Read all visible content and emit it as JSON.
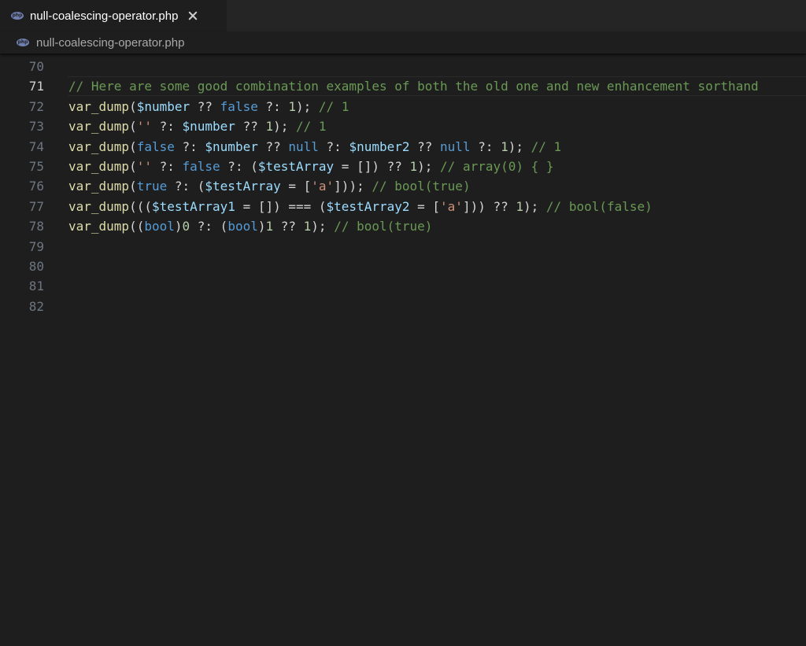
{
  "tab": {
    "label": "null-coalescing-operator.php",
    "icon": "php-file-icon"
  },
  "breadcrumb": {
    "label": "null-coalescing-operator.php",
    "icon": "php-file-icon"
  },
  "editor": {
    "current_line": 71,
    "lines": [
      {
        "number": "70",
        "tokens": []
      },
      {
        "number": "71",
        "tokens": [
          {
            "t": "cmt",
            "v": "// Here are some good combination examples of both the old one and new enhancement sorthand"
          }
        ]
      },
      {
        "number": "72",
        "tokens": [
          {
            "t": "fn",
            "v": "var_dump"
          },
          {
            "t": "pun",
            "v": "("
          },
          {
            "t": "var",
            "v": "$number"
          },
          {
            "t": "pun",
            "v": " ?? "
          },
          {
            "t": "kw",
            "v": "false"
          },
          {
            "t": "pun",
            "v": " ?: "
          },
          {
            "t": "num",
            "v": "1"
          },
          {
            "t": "pun",
            "v": "); "
          },
          {
            "t": "cmt",
            "v": "// 1"
          }
        ]
      },
      {
        "number": "73",
        "tokens": [
          {
            "t": "fn",
            "v": "var_dump"
          },
          {
            "t": "pun",
            "v": "("
          },
          {
            "t": "str",
            "v": "''"
          },
          {
            "t": "pun",
            "v": " ?: "
          },
          {
            "t": "var",
            "v": "$number"
          },
          {
            "t": "pun",
            "v": " ?? "
          },
          {
            "t": "num",
            "v": "1"
          },
          {
            "t": "pun",
            "v": "); "
          },
          {
            "t": "cmt",
            "v": "// 1"
          }
        ]
      },
      {
        "number": "74",
        "tokens": [
          {
            "t": "fn",
            "v": "var_dump"
          },
          {
            "t": "pun",
            "v": "("
          },
          {
            "t": "kw",
            "v": "false"
          },
          {
            "t": "pun",
            "v": " ?: "
          },
          {
            "t": "var",
            "v": "$number"
          },
          {
            "t": "pun",
            "v": " ?? "
          },
          {
            "t": "kw",
            "v": "null"
          },
          {
            "t": "pun",
            "v": " ?: "
          },
          {
            "t": "var",
            "v": "$number2"
          },
          {
            "t": "pun",
            "v": " ?? "
          },
          {
            "t": "kw",
            "v": "null"
          },
          {
            "t": "pun",
            "v": " ?: "
          },
          {
            "t": "num",
            "v": "1"
          },
          {
            "t": "pun",
            "v": "); "
          },
          {
            "t": "cmt",
            "v": "// 1"
          }
        ]
      },
      {
        "number": "75",
        "tokens": [
          {
            "t": "fn",
            "v": "var_dump"
          },
          {
            "t": "pun",
            "v": "("
          },
          {
            "t": "str",
            "v": "''"
          },
          {
            "t": "pun",
            "v": " ?: "
          },
          {
            "t": "kw",
            "v": "false"
          },
          {
            "t": "pun",
            "v": " ?: ("
          },
          {
            "t": "var",
            "v": "$testArray"
          },
          {
            "t": "pun",
            "v": " = []) ?? "
          },
          {
            "t": "num",
            "v": "1"
          },
          {
            "t": "pun",
            "v": "); "
          },
          {
            "t": "cmt",
            "v": "// array(0) { }"
          }
        ]
      },
      {
        "number": "76",
        "tokens": [
          {
            "t": "fn",
            "v": "var_dump"
          },
          {
            "t": "pun",
            "v": "("
          },
          {
            "t": "kw",
            "v": "true"
          },
          {
            "t": "pun",
            "v": " ?: ("
          },
          {
            "t": "var",
            "v": "$testArray"
          },
          {
            "t": "pun",
            "v": " = ["
          },
          {
            "t": "str",
            "v": "'a'"
          },
          {
            "t": "pun",
            "v": "])); "
          },
          {
            "t": "cmt",
            "v": "// bool(true)"
          }
        ]
      },
      {
        "number": "77",
        "tokens": [
          {
            "t": "fn",
            "v": "var_dump"
          },
          {
            "t": "pun",
            "v": "((("
          },
          {
            "t": "var",
            "v": "$testArray1"
          },
          {
            "t": "pun",
            "v": " = []) === ("
          },
          {
            "t": "var",
            "v": "$testArray2"
          },
          {
            "t": "pun",
            "v": " = ["
          },
          {
            "t": "str",
            "v": "'a'"
          },
          {
            "t": "pun",
            "v": "])) ?? "
          },
          {
            "t": "num",
            "v": "1"
          },
          {
            "t": "pun",
            "v": "); "
          },
          {
            "t": "cmt",
            "v": "// bool(false)"
          }
        ]
      },
      {
        "number": "78",
        "tokens": [
          {
            "t": "fn",
            "v": "var_dump"
          },
          {
            "t": "pun",
            "v": "(("
          },
          {
            "t": "kw",
            "v": "bool"
          },
          {
            "t": "pun",
            "v": ")"
          },
          {
            "t": "num",
            "v": "0"
          },
          {
            "t": "pun",
            "v": " ?: ("
          },
          {
            "t": "kw",
            "v": "bool"
          },
          {
            "t": "pun",
            "v": ")"
          },
          {
            "t": "num",
            "v": "1"
          },
          {
            "t": "pun",
            "v": " ?? "
          },
          {
            "t": "num",
            "v": "1"
          },
          {
            "t": "pun",
            "v": "); "
          },
          {
            "t": "cmt",
            "v": "// bool(true)"
          }
        ]
      },
      {
        "number": "79",
        "tokens": []
      },
      {
        "number": "80",
        "tokens": []
      },
      {
        "number": "81",
        "tokens": []
      },
      {
        "number": "82",
        "tokens": []
      }
    ]
  }
}
